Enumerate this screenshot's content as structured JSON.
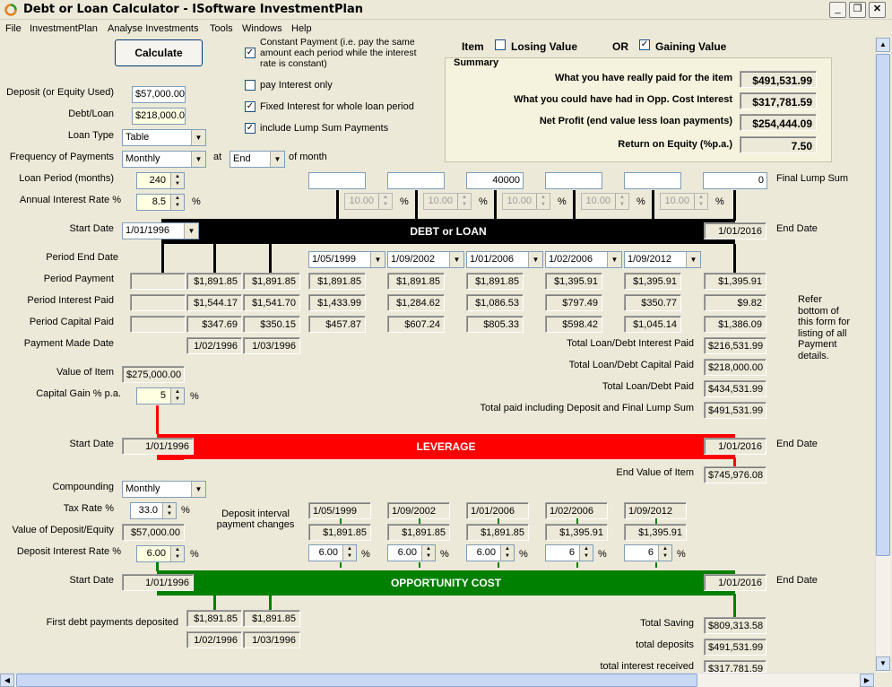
{
  "window": {
    "title": "Debt or Loan Calculator - ISoftware InvestmentPlan"
  },
  "menu": [
    "File",
    "InvestmentPlan",
    "Analyse Investments",
    "Tools",
    "Windows",
    "Help"
  ],
  "calculate_label": "Calculate",
  "options": {
    "constant_payment": "Constant Payment (i.e. pay the same amount each period while the interest rate is constant)",
    "pay_interest_only": "pay Interest only",
    "fixed_interest": "Fixed Interest for whole loan period",
    "lump_sum": "include Lump Sum Payments"
  },
  "item": {
    "label": "Item",
    "losing": "Losing Value",
    "or": "OR",
    "gaining": "Gaining Value"
  },
  "summary": {
    "title": "Summary",
    "rows": [
      {
        "label": "What you have really paid for the item",
        "value": "$491,531.99"
      },
      {
        "label": "What you could have had in Opp. Cost Interest",
        "value": "$317,781.59"
      },
      {
        "label": "Net Profit (end value less loan payments)",
        "value": "$254,444.09"
      },
      {
        "label": "Return on Equity (%p.a.)",
        "value": "7.50"
      }
    ]
  },
  "inputs": {
    "deposit_label": "Deposit (or Equity Used)",
    "deposit": "$57,000.00",
    "debt_label": "Debt/Loan",
    "debt": "$218,000.00",
    "loan_type_label": "Loan Type",
    "loan_type": "Table",
    "freq_label": "Frequency of Payments",
    "freq": "Monthly",
    "at": "at",
    "at_value": "End",
    "of_month": "of month",
    "period_label": "Loan Period (months)",
    "period": "240",
    "rate_label": "Annual Interest Rate %",
    "rate": "8.5",
    "pct": "%"
  },
  "lump": {
    "values": [
      "",
      "",
      "40000",
      "",
      "",
      "0"
    ],
    "final_label": "Final Lump Sum",
    "rates": [
      "10.00",
      "10.00",
      "10.00",
      "10.00",
      "10.00"
    ]
  },
  "debt_bar": {
    "start_label": "Start Date",
    "start": "1/01/1996",
    "title": "DEBT or LOAN",
    "end": "1/01/2016",
    "end_label": "End Date"
  },
  "period_end_label": "Period End Date",
  "period_dates": [
    "1/05/1999",
    "1/09/2002",
    "1/01/2006",
    "1/02/2006",
    "1/09/2012"
  ],
  "rows": {
    "labels": [
      "Period Payment",
      "Period Interest Paid",
      "Period Capital Paid",
      "Payment Made Date"
    ],
    "payment": [
      "",
      "$1,891.85",
      "$1,891.85",
      "$1,891.85",
      "$1,891.85",
      "$1,891.85",
      "$1,395.91",
      "$1,395.91",
      "$1,395.91"
    ],
    "interest": [
      "",
      "$1,544.17",
      "$1,541.70",
      "$1,433.99",
      "$1,284.62",
      "$1,086.53",
      "$797.49",
      "$350.77",
      "$9.82"
    ],
    "capital": [
      "",
      "$347.69",
      "$350.15",
      "$457.87",
      "$607.24",
      "$805.33",
      "$598.42",
      "$1,045.14",
      "$1,386.09"
    ],
    "made": [
      "1/02/1996",
      "1/03/1996"
    ]
  },
  "refer_note": "Refer bottom of this form for listing of all Payment details.",
  "totals": [
    {
      "label": "Total Loan/Debt Interest Paid",
      "value": "$216,531.99"
    },
    {
      "label": "Total Loan/Debt Capital Paid",
      "value": "$218,000.00"
    },
    {
      "label": "Total Loan/Debt Paid",
      "value": "$434,531.99"
    },
    {
      "label": "Total paid including Deposit and Final Lump Sum",
      "value": "$491,531.99"
    }
  ],
  "item_value": {
    "label": "Value of Item",
    "value": "$275,000.00",
    "gain_label": "Capital Gain % p.a.",
    "gain": "5"
  },
  "leverage": {
    "start_label": "Start Date",
    "start": "1/01/1996",
    "title": "LEVERAGE",
    "end": "1/01/2016",
    "end_label": "End Date",
    "end_value_label": "End Value of Item",
    "end_value": "$745,976.08"
  },
  "opp": {
    "compounding_label": "Compounding",
    "compounding": "Monthly",
    "tax_label": "Tax Rate %",
    "tax": "33.0",
    "deposit_value_label": "Value of Deposit/Equity",
    "deposit_value": "$57,000.00",
    "dep_rate_label": "Deposit Interest Rate %",
    "dep_rate": "6.00",
    "interval_label": "Deposit interval payment changes",
    "dates": [
      "1/05/1999",
      "1/09/2002",
      "1/01/2006",
      "1/02/2006",
      "1/09/2012"
    ],
    "payments": [
      "$1,891.85",
      "$1,891.85",
      "$1,891.85",
      "$1,395.91",
      "$1,395.91"
    ],
    "rates": [
      "6.00",
      "6.00",
      "6.00",
      "6",
      "6"
    ],
    "start_label": "Start Date",
    "start": "1/01/1996",
    "title": "OPPORTUNITY COST",
    "end": "1/01/2016",
    "end_label": "End Date",
    "first_label": "First debt payments deposited",
    "first": [
      "$1,891.85",
      "$1,891.85"
    ],
    "first_dates": [
      "1/02/1996",
      "1/03/1996"
    ],
    "totals": [
      {
        "label": "Total Saving",
        "value": "$809,313.58"
      },
      {
        "label": "total deposits",
        "value": "$491,531.99"
      },
      {
        "label": "total interest received",
        "value": "$317,781.59"
      }
    ]
  },
  "colors": {
    "debt": "#000000",
    "leverage": "#ff0000",
    "opp": "#008000"
  }
}
